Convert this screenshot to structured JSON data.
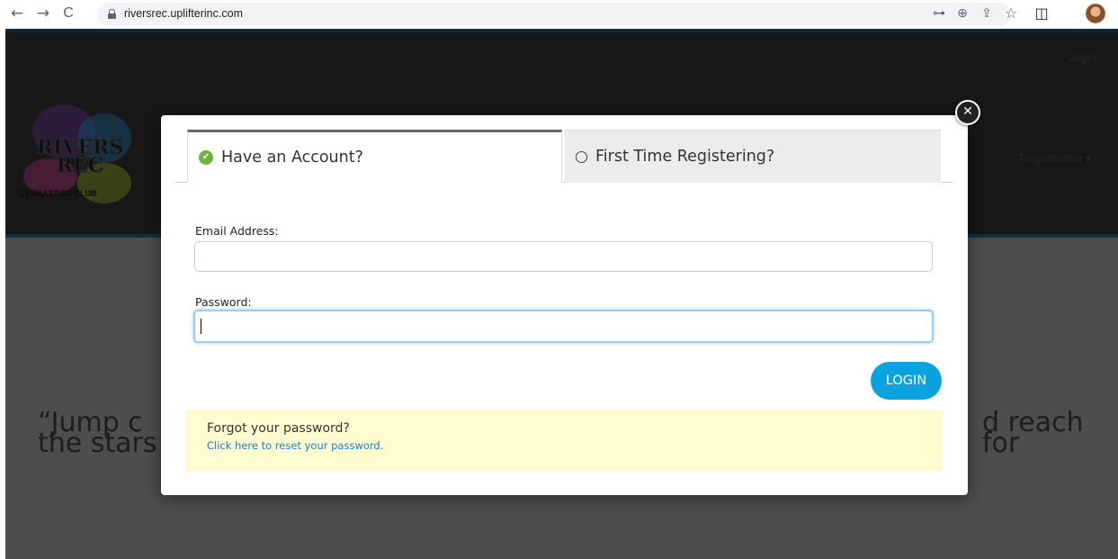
{
  "browser": {
    "url": "riversrec.uplifterinc.com",
    "back_glyph": "←",
    "forward_glyph": "→",
    "reload_glyph": "C",
    "key_glyph": "⊶",
    "zoom_glyph": "⊕",
    "share_glyph": "⇪",
    "star_glyph": "☆",
    "sidepanel_glyph": "◫"
  },
  "page": {
    "header_login": "Login",
    "header_registration": "Registration ▾",
    "logo_line1": "RIVERS",
    "logo_line2": "REC",
    "logo_sub": "GYMNASTICS CLUB",
    "quote_left": "“Jump c",
    "quote_left2": "the stars",
    "quote_right": "d reach for"
  },
  "modal": {
    "close_glyph": "✕",
    "tabs": [
      {
        "label": "Have an Account?",
        "active": true
      },
      {
        "label": "First Time Registering?",
        "active": false
      }
    ],
    "email_label": "Email Address:",
    "email_value": "",
    "password_label": "Password:",
    "password_value": "",
    "login_button": "LOGIN",
    "forgot_title": "Forgot your password?",
    "forgot_link": "Click here to reset your password."
  },
  "colors": {
    "accent": "#0aa3e0",
    "check": "#6db33f",
    "notice_bg": "#fffccf",
    "link": "#1a7fc1"
  }
}
